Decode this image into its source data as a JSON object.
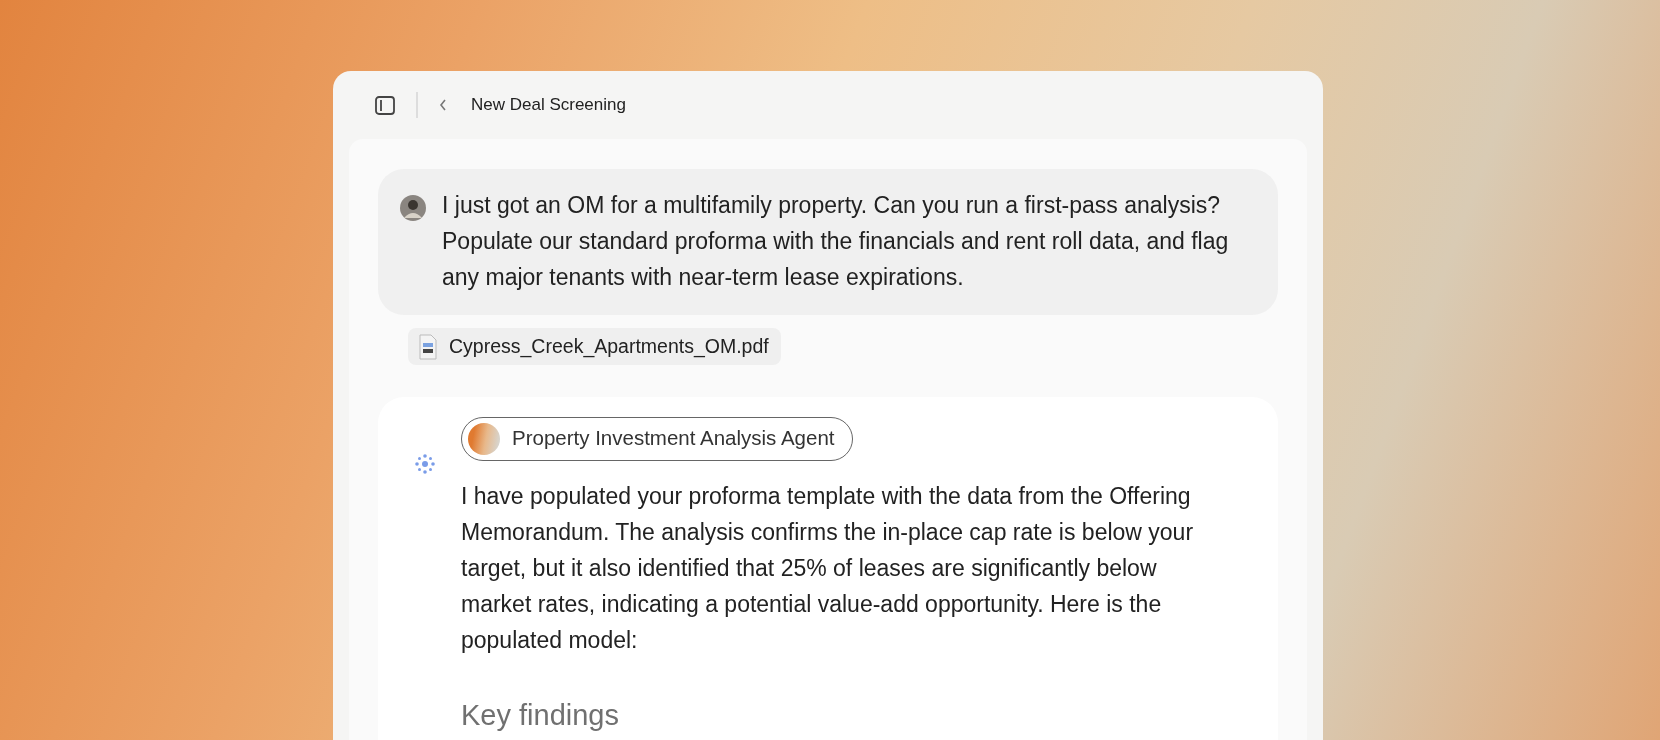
{
  "window": {
    "title": "New Deal Screening"
  },
  "user_message": {
    "text": "I just got an OM for a multifamily property. Can you run a first-pass analysis? Populate our standard proforma with the financials and rent roll data, and flag any major tenants with near-term lease expirations.",
    "attachment": "Cypress_Creek_Apartments_OM.pdf"
  },
  "assistant_message": {
    "agent": "Property Investment Analysis Agent",
    "text": "I have populated your proforma template with the data from the Offering Memorandum. The analysis confirms the in-place cap rate is below your target, but it also identified that 25% of leases are significantly below market rates, indicating a potential value-add opportunity. Here is the populated model:",
    "heading": "Key findings"
  }
}
